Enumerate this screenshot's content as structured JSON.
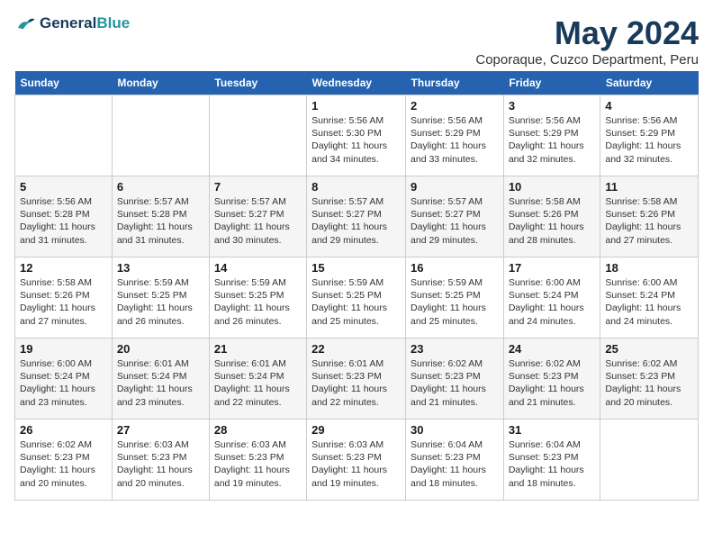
{
  "header": {
    "logo_line1": "General",
    "logo_line2": "Blue",
    "month_title": "May 2024",
    "location": "Coporaque, Cuzco Department, Peru"
  },
  "days_of_week": [
    "Sunday",
    "Monday",
    "Tuesday",
    "Wednesday",
    "Thursday",
    "Friday",
    "Saturday"
  ],
  "weeks": [
    [
      {
        "num": "",
        "info": ""
      },
      {
        "num": "",
        "info": ""
      },
      {
        "num": "",
        "info": ""
      },
      {
        "num": "1",
        "info": "Sunrise: 5:56 AM\nSunset: 5:30 PM\nDaylight: 11 hours\nand 34 minutes."
      },
      {
        "num": "2",
        "info": "Sunrise: 5:56 AM\nSunset: 5:29 PM\nDaylight: 11 hours\nand 33 minutes."
      },
      {
        "num": "3",
        "info": "Sunrise: 5:56 AM\nSunset: 5:29 PM\nDaylight: 11 hours\nand 32 minutes."
      },
      {
        "num": "4",
        "info": "Sunrise: 5:56 AM\nSunset: 5:29 PM\nDaylight: 11 hours\nand 32 minutes."
      }
    ],
    [
      {
        "num": "5",
        "info": "Sunrise: 5:56 AM\nSunset: 5:28 PM\nDaylight: 11 hours\nand 31 minutes."
      },
      {
        "num": "6",
        "info": "Sunrise: 5:57 AM\nSunset: 5:28 PM\nDaylight: 11 hours\nand 31 minutes."
      },
      {
        "num": "7",
        "info": "Sunrise: 5:57 AM\nSunset: 5:27 PM\nDaylight: 11 hours\nand 30 minutes."
      },
      {
        "num": "8",
        "info": "Sunrise: 5:57 AM\nSunset: 5:27 PM\nDaylight: 11 hours\nand 29 minutes."
      },
      {
        "num": "9",
        "info": "Sunrise: 5:57 AM\nSunset: 5:27 PM\nDaylight: 11 hours\nand 29 minutes."
      },
      {
        "num": "10",
        "info": "Sunrise: 5:58 AM\nSunset: 5:26 PM\nDaylight: 11 hours\nand 28 minutes."
      },
      {
        "num": "11",
        "info": "Sunrise: 5:58 AM\nSunset: 5:26 PM\nDaylight: 11 hours\nand 27 minutes."
      }
    ],
    [
      {
        "num": "12",
        "info": "Sunrise: 5:58 AM\nSunset: 5:26 PM\nDaylight: 11 hours\nand 27 minutes."
      },
      {
        "num": "13",
        "info": "Sunrise: 5:59 AM\nSunset: 5:25 PM\nDaylight: 11 hours\nand 26 minutes."
      },
      {
        "num": "14",
        "info": "Sunrise: 5:59 AM\nSunset: 5:25 PM\nDaylight: 11 hours\nand 26 minutes."
      },
      {
        "num": "15",
        "info": "Sunrise: 5:59 AM\nSunset: 5:25 PM\nDaylight: 11 hours\nand 25 minutes."
      },
      {
        "num": "16",
        "info": "Sunrise: 5:59 AM\nSunset: 5:25 PM\nDaylight: 11 hours\nand 25 minutes."
      },
      {
        "num": "17",
        "info": "Sunrise: 6:00 AM\nSunset: 5:24 PM\nDaylight: 11 hours\nand 24 minutes."
      },
      {
        "num": "18",
        "info": "Sunrise: 6:00 AM\nSunset: 5:24 PM\nDaylight: 11 hours\nand 24 minutes."
      }
    ],
    [
      {
        "num": "19",
        "info": "Sunrise: 6:00 AM\nSunset: 5:24 PM\nDaylight: 11 hours\nand 23 minutes."
      },
      {
        "num": "20",
        "info": "Sunrise: 6:01 AM\nSunset: 5:24 PM\nDaylight: 11 hours\nand 23 minutes."
      },
      {
        "num": "21",
        "info": "Sunrise: 6:01 AM\nSunset: 5:24 PM\nDaylight: 11 hours\nand 22 minutes."
      },
      {
        "num": "22",
        "info": "Sunrise: 6:01 AM\nSunset: 5:23 PM\nDaylight: 11 hours\nand 22 minutes."
      },
      {
        "num": "23",
        "info": "Sunrise: 6:02 AM\nSunset: 5:23 PM\nDaylight: 11 hours\nand 21 minutes."
      },
      {
        "num": "24",
        "info": "Sunrise: 6:02 AM\nSunset: 5:23 PM\nDaylight: 11 hours\nand 21 minutes."
      },
      {
        "num": "25",
        "info": "Sunrise: 6:02 AM\nSunset: 5:23 PM\nDaylight: 11 hours\nand 20 minutes."
      }
    ],
    [
      {
        "num": "26",
        "info": "Sunrise: 6:02 AM\nSunset: 5:23 PM\nDaylight: 11 hours\nand 20 minutes."
      },
      {
        "num": "27",
        "info": "Sunrise: 6:03 AM\nSunset: 5:23 PM\nDaylight: 11 hours\nand 20 minutes."
      },
      {
        "num": "28",
        "info": "Sunrise: 6:03 AM\nSunset: 5:23 PM\nDaylight: 11 hours\nand 19 minutes."
      },
      {
        "num": "29",
        "info": "Sunrise: 6:03 AM\nSunset: 5:23 PM\nDaylight: 11 hours\nand 19 minutes."
      },
      {
        "num": "30",
        "info": "Sunrise: 6:04 AM\nSunset: 5:23 PM\nDaylight: 11 hours\nand 18 minutes."
      },
      {
        "num": "31",
        "info": "Sunrise: 6:04 AM\nSunset: 5:23 PM\nDaylight: 11 hours\nand 18 minutes."
      },
      {
        "num": "",
        "info": ""
      }
    ]
  ]
}
